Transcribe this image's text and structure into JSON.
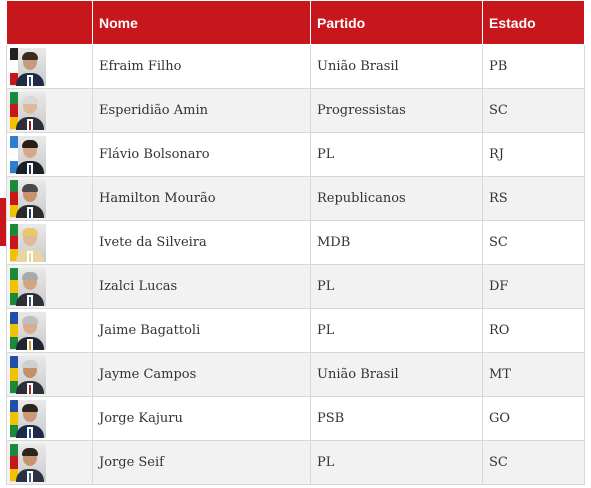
{
  "table": {
    "headers": {
      "photo": "",
      "name": "Nome",
      "party": "Partido",
      "state": "Estado"
    },
    "rows": [
      {
        "name": "Efraim Filho",
        "party": "União Brasil",
        "state": "PB",
        "portrait": "senator-portrait"
      },
      {
        "name": "Esperidião Amin",
        "party": "Progressistas",
        "state": "SC",
        "portrait": "senator-portrait"
      },
      {
        "name": "Flávio Bolsonaro",
        "party": "PL",
        "state": "RJ",
        "portrait": "senator-portrait"
      },
      {
        "name": "Hamilton Mourão",
        "party": "Republicanos",
        "state": "RS",
        "portrait": "senator-portrait"
      },
      {
        "name": "Ivete da Silveira",
        "party": "MDB",
        "state": "SC",
        "portrait": "senator-portrait"
      },
      {
        "name": "Izalci Lucas",
        "party": "PL",
        "state": "DF",
        "portrait": "senator-portrait"
      },
      {
        "name": "Jaime Bagattoli",
        "party": "PL",
        "state": "RO",
        "portrait": "senator-portrait"
      },
      {
        "name": "Jayme Campos",
        "party": "União Brasil",
        "state": "MT",
        "portrait": "senator-portrait"
      },
      {
        "name": "Jorge Kajuru",
        "party": "PSB",
        "state": "GO",
        "portrait": "senator-portrait"
      },
      {
        "name": "Jorge Seif",
        "party": "PL",
        "state": "SC",
        "portrait": "senator-portrait"
      }
    ]
  },
  "colors": {
    "header_background": "#c8161d",
    "header_text": "#ffffff",
    "row_alt_background": "#f2f2f2",
    "cell_text": "#333333",
    "border": "#d8d8d8"
  }
}
